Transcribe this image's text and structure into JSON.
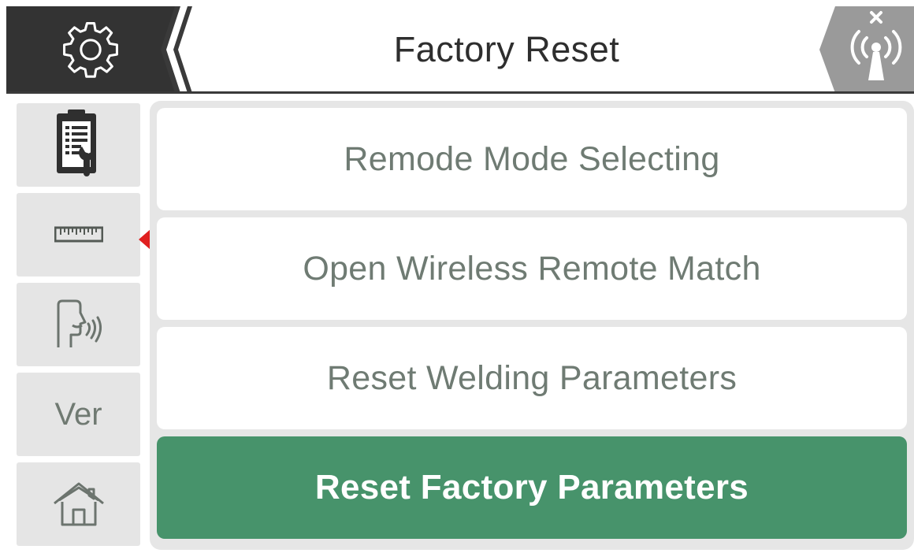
{
  "header": {
    "title": "Factory Reset",
    "settings_icon": "gear-icon",
    "back_icon": "chevron-left-icon",
    "wireless_icon": "wireless-antenna-disconnected-icon"
  },
  "sidebar": {
    "items": [
      {
        "id": "params",
        "icon": "clipboard-wrench-icon",
        "label": ""
      },
      {
        "id": "ruler",
        "icon": "ruler-icon",
        "label": ""
      },
      {
        "id": "voice",
        "icon": "voice-speech-icon",
        "label": ""
      },
      {
        "id": "version",
        "icon": "",
        "label": "Ver"
      },
      {
        "id": "home",
        "icon": "home-icon",
        "label": ""
      }
    ],
    "selected_index": 0
  },
  "menu": {
    "items": [
      {
        "label": "Remode Mode Selecting",
        "active": false
      },
      {
        "label": "Open Wireless Remote Match",
        "active": false
      },
      {
        "label": "Reset Welding Parameters",
        "active": false
      },
      {
        "label": "Reset Factory Parameters",
        "active": true
      }
    ]
  },
  "colors": {
    "header_dark": "#333333",
    "accent_green": "#47936b",
    "pointer_red": "#e02020",
    "menu_text_gray": "#6f7b73",
    "panel_gray": "#e6e6e6"
  }
}
